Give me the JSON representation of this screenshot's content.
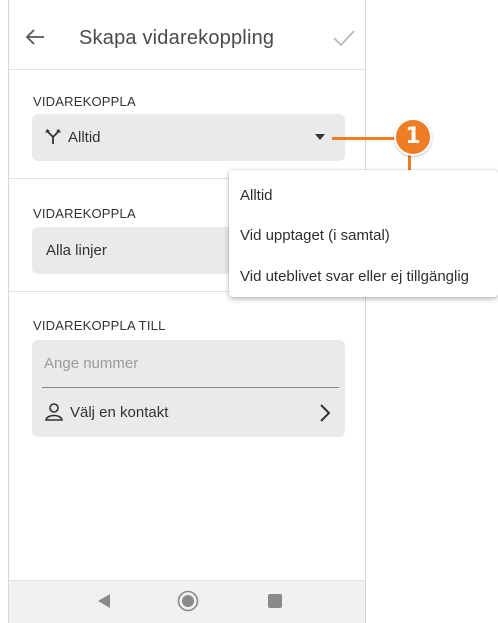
{
  "appbar": {
    "title": "Skapa vidarekoppling",
    "back_icon": "arrow-left-icon",
    "confirm_icon": "check-icon"
  },
  "section1": {
    "label": "VIDAREKOPPLA",
    "selected": "Alltid",
    "icon": "route-split-icon"
  },
  "section2": {
    "label": "VIDAREKOPPLA",
    "selected": "Alla linjer"
  },
  "section3": {
    "label": "VIDAREKOPPLA TILL",
    "number_placeholder": "Ange nummer",
    "contact_label": "Välj en kontakt"
  },
  "dropdown": {
    "items": [
      {
        "label": "Alltid"
      },
      {
        "label": "Vid upptaget (i samtal)"
      },
      {
        "label": "Vid uteblivet svar eller ej tillgänglig"
      }
    ]
  },
  "callout": {
    "number": "1",
    "color": "#ef7d25"
  },
  "colors": {
    "field_bg": "#eaeaea",
    "navbar_bg": "#f1f1f1",
    "accent": "#ef7d25"
  }
}
